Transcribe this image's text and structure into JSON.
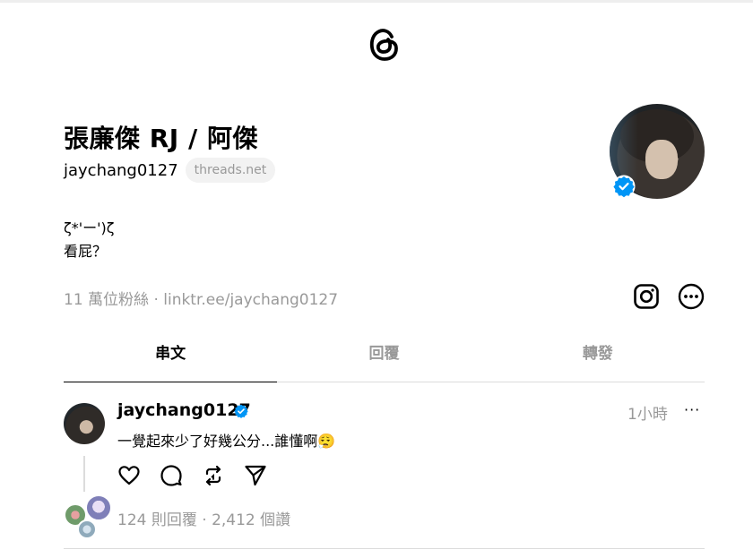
{
  "profile": {
    "display_name": "張廉傑 RJ / 阿傑",
    "handle": "jaychang0127",
    "domain_pill": "threads.net",
    "bio_line1": "ζ*'ー')ζ",
    "bio_line2": "看屁？",
    "followers": "11 萬位粉絲 · linktr.ee/jaychang0127"
  },
  "tabs": [
    "串文",
    "回覆",
    "轉發"
  ],
  "post": {
    "username": "jaychang0127",
    "time": "1小時",
    "more": "···",
    "text": "一覺起來少了好幾公分...誰懂啊😮‍💨",
    "stats": "124 則回覆 · 2,412 個讚"
  },
  "icons": {
    "logo": "threads-logo-icon",
    "instagram": "instagram-icon",
    "more": "more-circle-icon",
    "like": "heart-icon",
    "reply": "comment-icon",
    "repost": "repost-icon",
    "share": "send-icon",
    "verified": "verified-badge-icon"
  },
  "colors": {
    "verified": "#0095f6",
    "muted": "#999999"
  }
}
